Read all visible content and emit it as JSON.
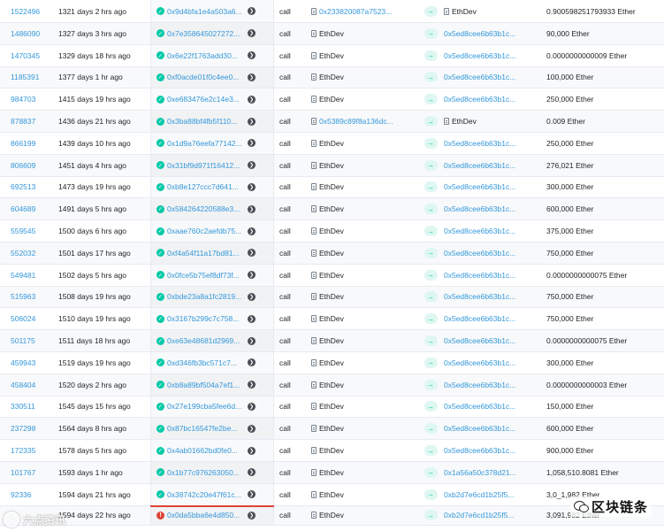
{
  "transactions": [
    {
      "block": "1522496",
      "age": "1321 days 2 hrs ago",
      "hash": "0x9d4bfa1e4a503a6...",
      "status": "success",
      "type": "call",
      "from": "0x233820087a7523...",
      "from_contract": true,
      "to": "EthDev",
      "to_contract": true,
      "value": "0.900598251793933 Ether"
    },
    {
      "block": "1486090",
      "age": "1327 days 3 hrs ago",
      "hash": "0x7e358645027272...",
      "status": "success",
      "type": "call",
      "from": "EthDev",
      "from_contract": true,
      "to": "0x5ed8cee6b63b1c...",
      "to_contract": false,
      "value": "90,000 Ether"
    },
    {
      "block": "1470345",
      "age": "1329 days 18 hrs ago",
      "hash": "0x6e22f1763add30...",
      "status": "success",
      "type": "call",
      "from": "EthDev",
      "from_contract": true,
      "to": "0x5ed8cee6b63b1c...",
      "to_contract": false,
      "value": "0.0000000000009 Ether"
    },
    {
      "block": "1185391",
      "age": "1377 days 1 hr ago",
      "hash": "0xf0acde01f0c4ee0...",
      "status": "success",
      "type": "call",
      "from": "EthDev",
      "from_contract": true,
      "to": "0x5ed8cee6b63b1c...",
      "to_contract": false,
      "value": "100,000 Ether"
    },
    {
      "block": "984703",
      "age": "1415 days 19 hrs ago",
      "hash": "0xe683476e2c14e3...",
      "status": "success",
      "type": "call",
      "from": "EthDev",
      "from_contract": true,
      "to": "0x5ed8cee6b63b1c...",
      "to_contract": false,
      "value": "250,000 Ether"
    },
    {
      "block": "878837",
      "age": "1436 days 21 hrs ago",
      "hash": "0x3ba88bf4fb5f110...",
      "status": "success",
      "type": "call",
      "from": "0x5389c89f8a136dc...",
      "from_contract": true,
      "to": "EthDev",
      "to_contract": true,
      "value": "0.009 Ether"
    },
    {
      "block": "866199",
      "age": "1439 days 10 hrs ago",
      "hash": "0x1d9a76eefa77142...",
      "status": "success",
      "type": "call",
      "from": "EthDev",
      "from_contract": true,
      "to": "0x5ed8cee6b63b1c...",
      "to_contract": false,
      "value": "250,000 Ether"
    },
    {
      "block": "806609",
      "age": "1451 days 4 hrs ago",
      "hash": "0x31bf9d971f16412...",
      "status": "success",
      "type": "call",
      "from": "EthDev",
      "from_contract": true,
      "to": "0x5ed8cee6b63b1c...",
      "to_contract": false,
      "value": "276,021 Ether"
    },
    {
      "block": "692513",
      "age": "1473 days 19 hrs ago",
      "hash": "0xb8e127ccc7d641...",
      "status": "success",
      "type": "call",
      "from": "EthDev",
      "from_contract": true,
      "to": "0x5ed8cee6b63b1c...",
      "to_contract": false,
      "value": "300,000 Ether"
    },
    {
      "block": "604689",
      "age": "1491 days 5 hrs ago",
      "hash": "0x584264220588e3...",
      "status": "success",
      "type": "call",
      "from": "EthDev",
      "from_contract": true,
      "to": "0x5ed8cee6b63b1c...",
      "to_contract": false,
      "value": "600,000 Ether"
    },
    {
      "block": "559545",
      "age": "1500 days 6 hrs ago",
      "hash": "0xaae760c2aefdb75...",
      "status": "success",
      "type": "call",
      "from": "EthDev",
      "from_contract": true,
      "to": "0x5ed8cee6b63b1c...",
      "to_contract": false,
      "value": "375,000 Ether"
    },
    {
      "block": "552032",
      "age": "1501 days 17 hrs ago",
      "hash": "0xf4a54f11a17bd81...",
      "status": "success",
      "type": "call",
      "from": "EthDev",
      "from_contract": true,
      "to": "0x5ed8cee6b63b1c...",
      "to_contract": false,
      "value": "750,000 Ether"
    },
    {
      "block": "549481",
      "age": "1502 days 5 hrs ago",
      "hash": "0x0fce5b75ef8df73f...",
      "status": "success",
      "type": "call",
      "from": "EthDev",
      "from_contract": true,
      "to": "0x5ed8cee6b63b1c...",
      "to_contract": false,
      "value": "0.0000000000075 Ether"
    },
    {
      "block": "515963",
      "age": "1508 days 19 hrs ago",
      "hash": "0xbde23a8a1fc2819...",
      "status": "success",
      "type": "call",
      "from": "EthDev",
      "from_contract": true,
      "to": "0x5ed8cee6b63b1c...",
      "to_contract": false,
      "value": "750,000 Ether"
    },
    {
      "block": "506024",
      "age": "1510 days 19 hrs ago",
      "hash": "0x3167b299c7c758...",
      "status": "success",
      "type": "call",
      "from": "EthDev",
      "from_contract": true,
      "to": "0x5ed8cee6b63b1c...",
      "to_contract": false,
      "value": "750,000 Ether"
    },
    {
      "block": "501175",
      "age": "1511 days 18 hrs ago",
      "hash": "0xe63e48681d2969...",
      "status": "success",
      "type": "call",
      "from": "EthDev",
      "from_contract": true,
      "to": "0x5ed8cee6b63b1c...",
      "to_contract": false,
      "value": "0.0000000000075 Ether"
    },
    {
      "block": "459943",
      "age": "1519 days 19 hrs ago",
      "hash": "0xd346fb3bc571c7...",
      "status": "success",
      "type": "call",
      "from": "EthDev",
      "from_contract": true,
      "to": "0x5ed8cee6b63b1c...",
      "to_contract": false,
      "value": "300,000 Ether"
    },
    {
      "block": "458404",
      "age": "1520 days 2 hrs ago",
      "hash": "0xb8a89bf504a7ef1...",
      "status": "success",
      "type": "call",
      "from": "EthDev",
      "from_contract": true,
      "to": "0x5ed8cee6b63b1c...",
      "to_contract": false,
      "value": "0.0000000000003 Ether"
    },
    {
      "block": "330511",
      "age": "1545 days 15 hrs ago",
      "hash": "0x27e199cba5fee6d...",
      "status": "success",
      "type": "call",
      "from": "EthDev",
      "from_contract": true,
      "to": "0x5ed8cee6b63b1c...",
      "to_contract": false,
      "value": "150,000 Ether"
    },
    {
      "block": "237298",
      "age": "1564 days 8 hrs ago",
      "hash": "0x87bc16547fe2be...",
      "status": "success",
      "type": "call",
      "from": "EthDev",
      "from_contract": true,
      "to": "0x5ed8cee6b63b1c...",
      "to_contract": false,
      "value": "600,000 Ether"
    },
    {
      "block": "172335",
      "age": "1578 days 5 hrs ago",
      "hash": "0x4ab01662bd0fe0...",
      "status": "success",
      "type": "call",
      "from": "EthDev",
      "from_contract": true,
      "to": "0x5ed8cee6b63b1c...",
      "to_contract": false,
      "value": "900,000 Ether"
    },
    {
      "block": "101767",
      "age": "1593 days 1 hr ago",
      "hash": "0x1b77c976263050...",
      "status": "success",
      "type": "call",
      "from": "EthDev",
      "from_contract": true,
      "to": "0x1a56a50c378d21...",
      "to_contract": false,
      "value": "1,058,510.8081 Ether"
    },
    {
      "block": "92336",
      "age": "1594 days 21 hrs ago",
      "hash": "0x38742c20e47f61c...",
      "status": "success",
      "type": "call",
      "from": "EthDev",
      "from_contract": true,
      "to": "0xb2d7e6cd1b25f5...",
      "to_contract": false,
      "value": "3,0_1,982 Ether"
    },
    {
      "block": "",
      "age": "1594 days 22 hrs ago",
      "hash": "0x0da5bba6e4d850...",
      "status": "error",
      "type": "call",
      "from": "EthDev",
      "from_contract": true,
      "to": "0xb2d7e6cd1b25f5...",
      "to_contract": false,
      "value": "3,091,982 Ether"
    }
  ],
  "watermark_left": "六点资讯",
  "watermark_right": "区块链条",
  "colors": {
    "link": "#3498db",
    "success": "#00c9a7",
    "error": "#de4437"
  }
}
